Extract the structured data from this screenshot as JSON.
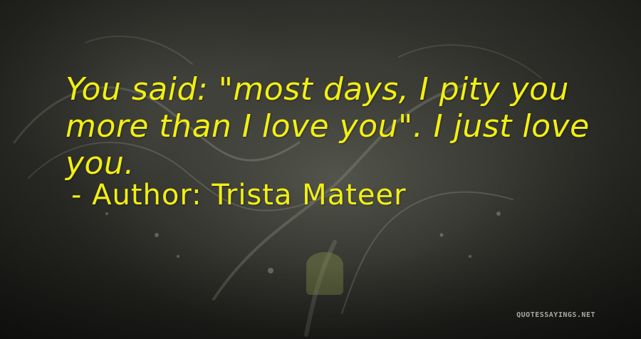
{
  "quote": {
    "text": "You said: \"most days, I pity you more than I love you\".   I just love you.",
    "author_prefix": "- Author:",
    "author": "Trista Mateer"
  },
  "watermark": {
    "text": "QUOTESSAYINGS.NET"
  },
  "colors": {
    "text": "#f2ef12",
    "background": "#34352f"
  }
}
